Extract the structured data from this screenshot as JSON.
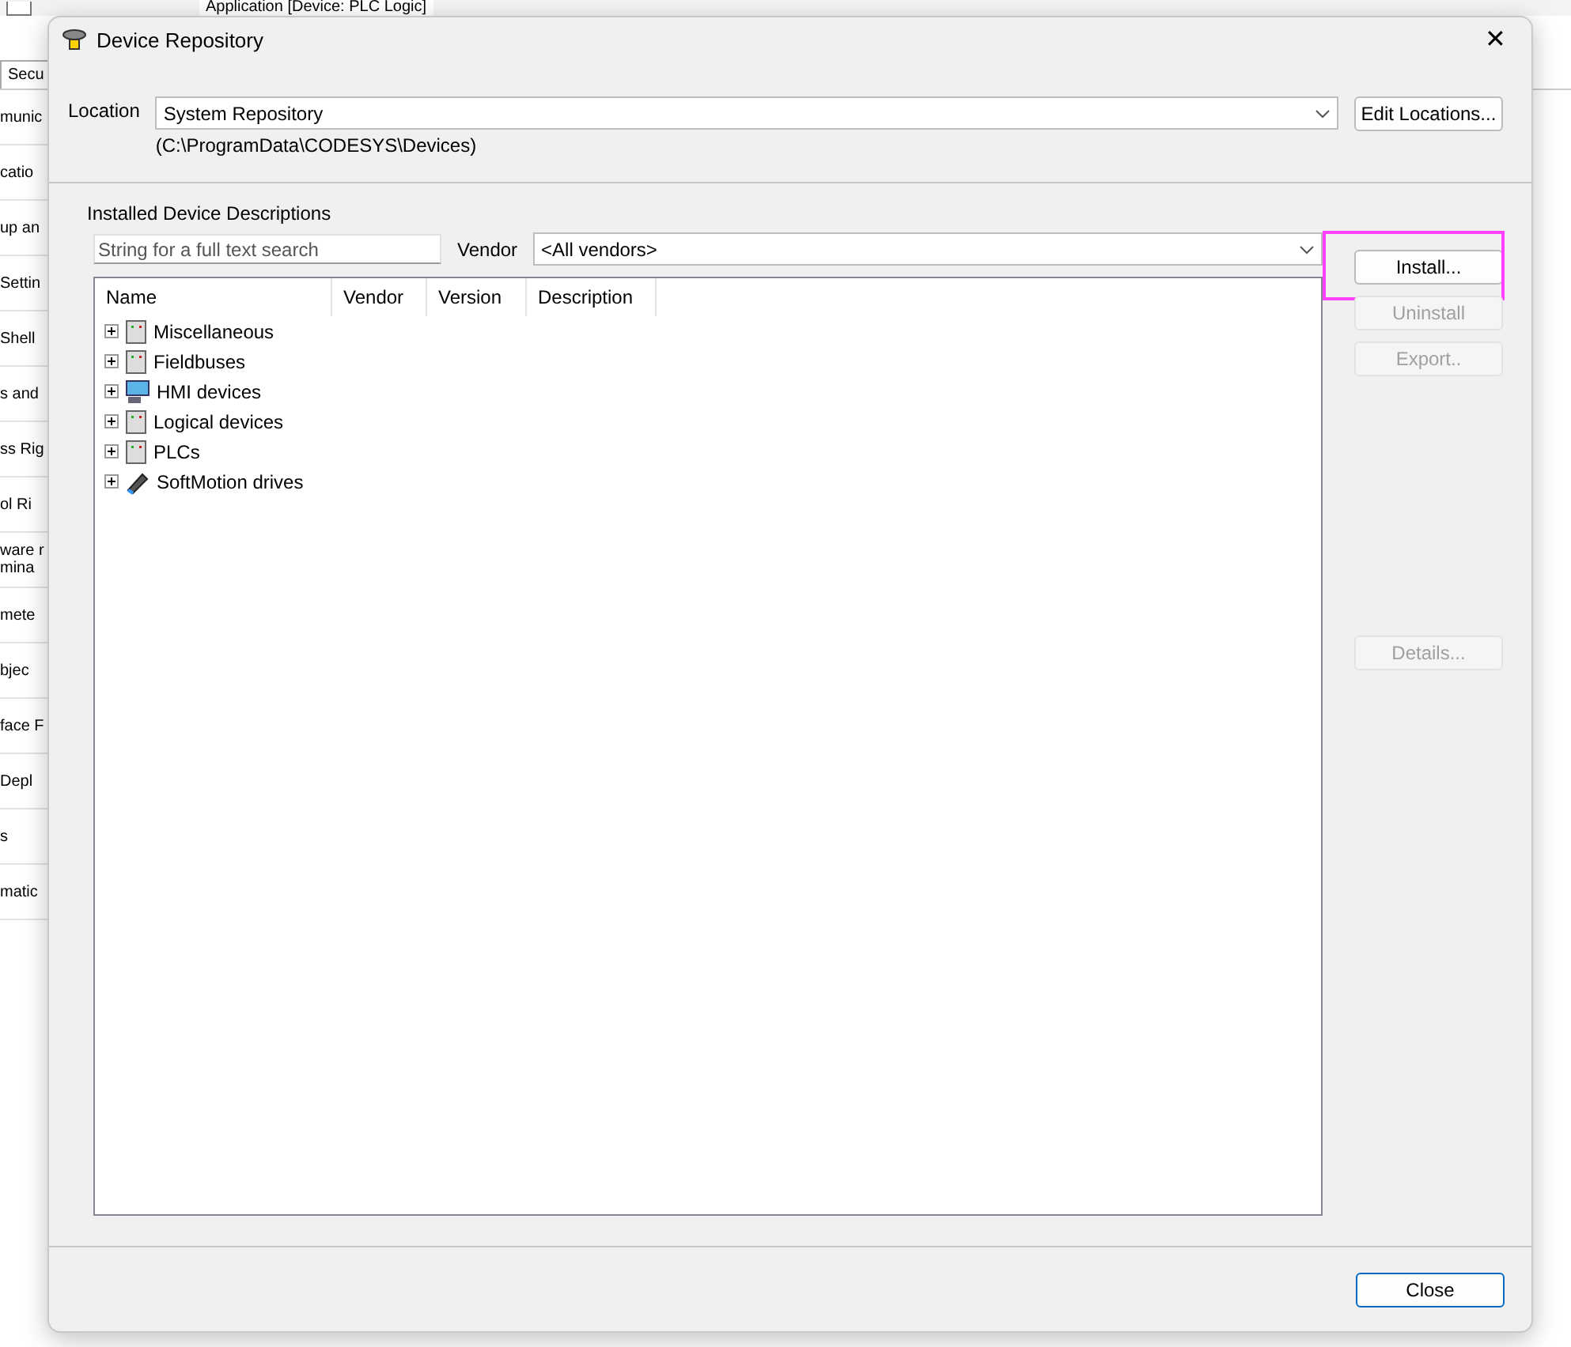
{
  "background": {
    "toolbar_tab": "Application [Device: PLC Logic]",
    "tab": "Secu",
    "side_items": [
      "munic",
      "catio",
      "up an",
      "Settin",
      "Shell",
      "s and",
      "ss Rig",
      "ol Ri",
      "ware r\nmina",
      "mete",
      "bjec",
      "face F",
      "Depl",
      "s",
      "matic"
    ]
  },
  "dialog": {
    "title": "Device Repository",
    "close_glyph": "✕",
    "location": {
      "label": "Location",
      "value": "System Repository",
      "path": "(C:\\ProgramData\\CODESYS\\Devices)",
      "button": "Edit Locations..."
    },
    "section_title": "Installed Device Descriptions",
    "search": {
      "placeholder": "String for a full text search"
    },
    "vendor": {
      "label": "Vendor",
      "value": "<All vendors>"
    },
    "columns": [
      "Name",
      "Vendor",
      "Version",
      "Description"
    ],
    "tree": [
      {
        "label": "Miscellaneous",
        "kind": "device",
        "expanded": false
      },
      {
        "label": "Fieldbuses",
        "kind": "device",
        "expanded": false
      },
      {
        "label": "HMI devices",
        "kind": "hmi",
        "expanded": false
      },
      {
        "label": "Logical devices",
        "kind": "device",
        "expanded": false
      },
      {
        "label": "PLCs",
        "kind": "device",
        "expanded": false
      },
      {
        "label": "SoftMotion drives",
        "kind": "drive",
        "expanded": false
      }
    ],
    "side_buttons": [
      {
        "label": "Install...",
        "disabled": false,
        "highlighted": true
      },
      {
        "label": "Uninstall",
        "disabled": true,
        "highlighted": false
      },
      {
        "label": "Export..",
        "disabled": true,
        "highlighted": false
      },
      {
        "label": "Details...",
        "disabled": true,
        "highlighted": false
      }
    ],
    "close_button": {
      "label": "Close",
      "focused": true
    }
  }
}
